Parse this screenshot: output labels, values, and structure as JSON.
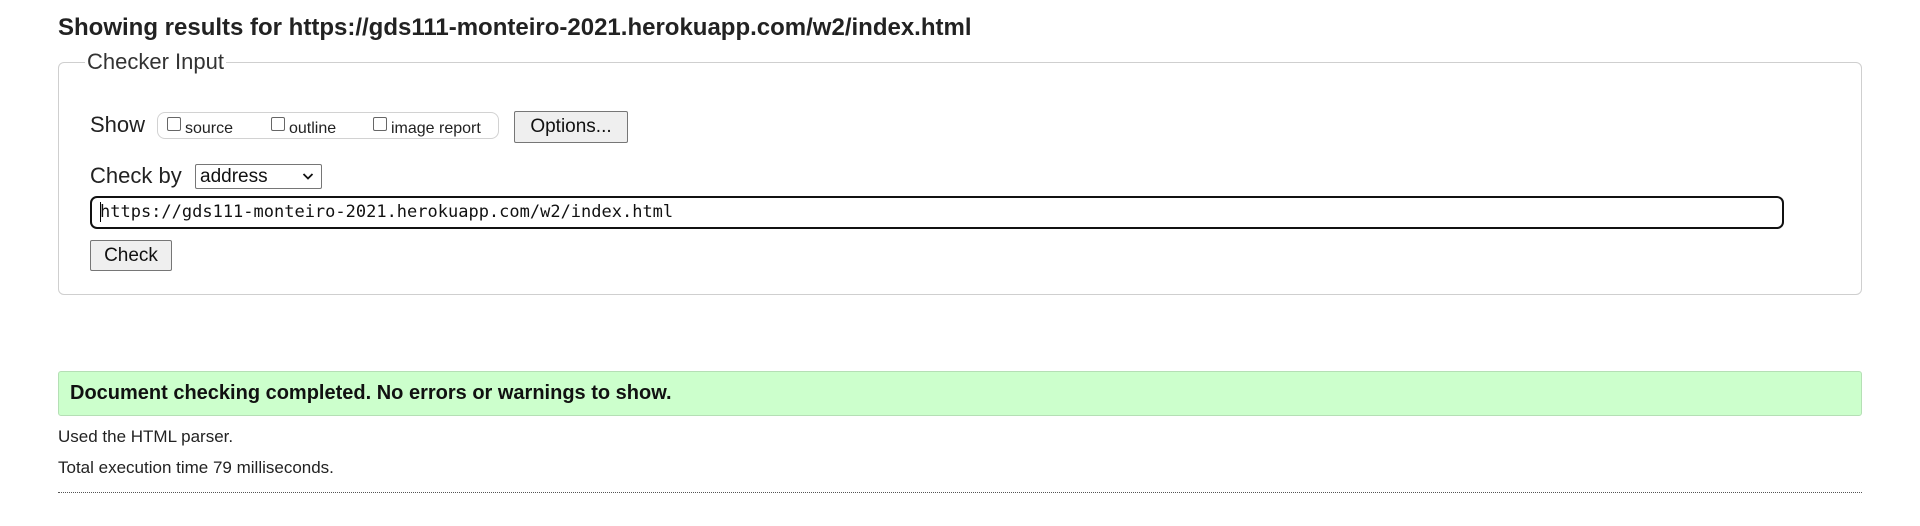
{
  "heading": "Showing results for https://gds111-monteiro-2021.herokuapp.com/w2/index.html",
  "checker": {
    "legend": "Checker Input",
    "show_label": "Show",
    "show_options": [
      {
        "label": "source",
        "checked": false
      },
      {
        "label": "outline",
        "checked": false
      },
      {
        "label": "image report",
        "checked": false
      }
    ],
    "options_button": "Options...",
    "check_by_label": "Check by",
    "check_by_selected": "address",
    "url_value": "https://gds111-monteiro-2021.herokuapp.com/w2/index.html",
    "check_button": "Check"
  },
  "result": {
    "message": "Document checking completed. No errors or warnings to show.",
    "parser_note": "Used the HTML parser.",
    "execution_time": "Total execution time 79 milliseconds."
  },
  "colors": {
    "success_background": "#ccffcc"
  },
  "icons": {
    "select_arrow": "chevron-down-icon"
  }
}
